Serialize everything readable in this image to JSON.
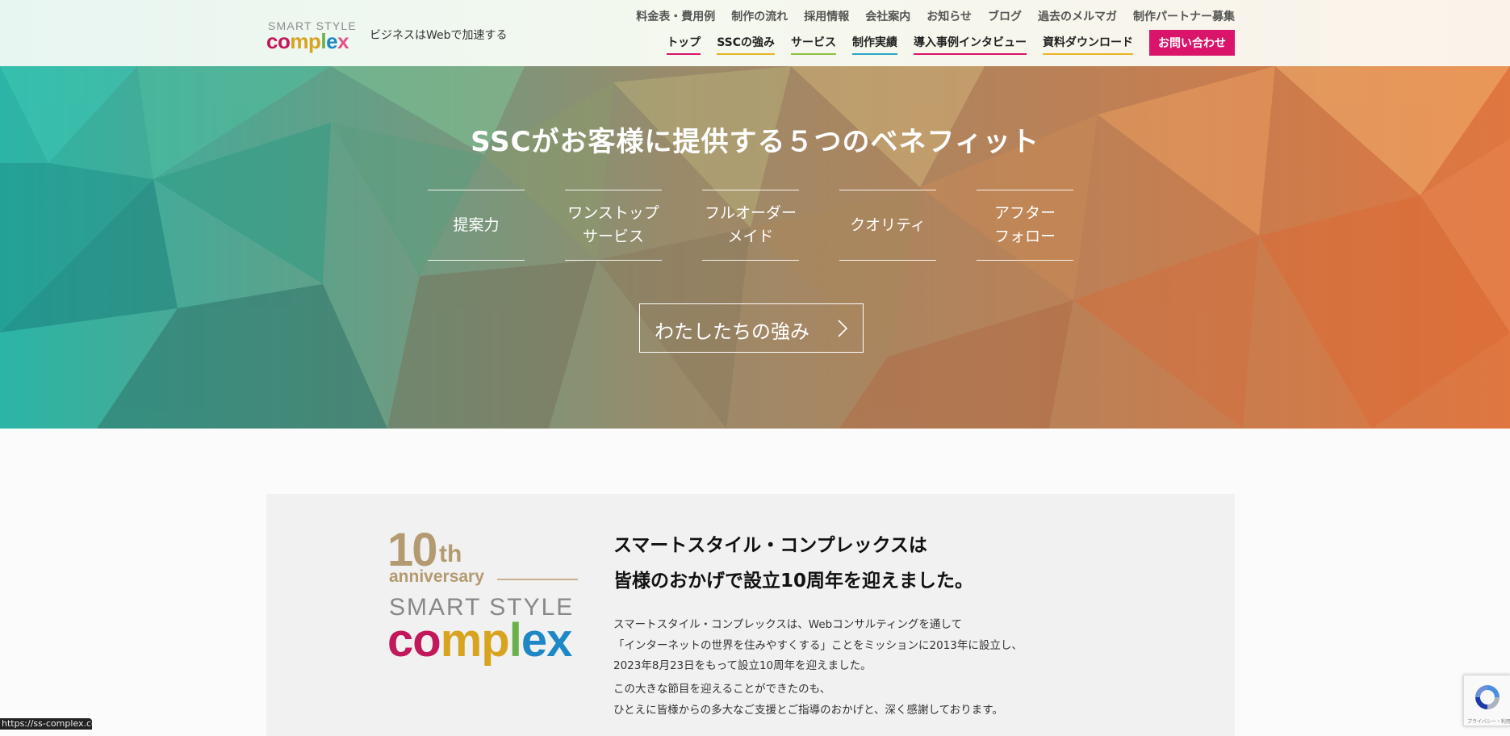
{
  "header": {
    "logo": {
      "small_text": "SMART STYLE",
      "letters": [
        {
          "ch": "c",
          "color": "#c2185b"
        },
        {
          "ch": "o",
          "color": "#c2185b"
        },
        {
          "ch": "m",
          "color": "#d8a31f"
        },
        {
          "ch": "p",
          "color": "#d8a31f"
        },
        {
          "ch": "l",
          "color": "#6ab04c"
        },
        {
          "ch": "e",
          "color": "#1e88c7"
        },
        {
          "ch": "x",
          "color": "#e94e8a"
        }
      ]
    },
    "tagline": "ビジネスはWebで加速する",
    "top_links": [
      {
        "label": "料金表・費用例"
      },
      {
        "label": "制作の流れ"
      },
      {
        "label": "採用情報"
      },
      {
        "label": "会社案内"
      },
      {
        "label": "お知らせ"
      },
      {
        "label": "ブログ"
      },
      {
        "label": "過去のメルマガ"
      },
      {
        "label": "制作パートナー募集"
      }
    ],
    "main_nav": [
      {
        "label": "トップ",
        "underline": "#d9146a"
      },
      {
        "label": "SSCの強み",
        "underline": "#e6b422"
      },
      {
        "label": "サービス",
        "underline": "#8bbf3f"
      },
      {
        "label": "制作実績",
        "underline": "#2aa6c9"
      },
      {
        "label": "導入事例インタビュー",
        "underline": "#d9146a"
      },
      {
        "label": "資料ダウンロード",
        "underline": "#e6b422"
      }
    ],
    "contact_label": "お問い合わせ",
    "contact_color": "#d9146a"
  },
  "hero": {
    "title": "SSCがお客様に提供する５つのベネフィット",
    "benefits": [
      {
        "label": "提案力"
      },
      {
        "label": "ワンストップ\nサービス"
      },
      {
        "label": "フルオーダー\nメイド"
      },
      {
        "label": "クオリティ"
      },
      {
        "label": "アフター\nフォロー"
      }
    ],
    "button_label": "わたしたちの強み",
    "colors": {
      "left": "#2bb5a6",
      "middle": "#9a8a6a",
      "right": "#e07640"
    }
  },
  "anniversary": {
    "logo": {
      "number": "10",
      "suffix": "th",
      "word": "anniversary",
      "small_text": "SMART STYLE",
      "letters": [
        {
          "ch": "c",
          "color": "#c2185b"
        },
        {
          "ch": "o",
          "color": "#c2185b"
        },
        {
          "ch": "m",
          "color": "#d8a31f"
        },
        {
          "ch": "p",
          "color": "#d8a31f"
        },
        {
          "ch": "l",
          "color": "#6ab04c"
        },
        {
          "ch": "e",
          "color": "#1e88c7"
        },
        {
          "ch": "x",
          "color": "#1e88c7"
        }
      ]
    },
    "heading_line1": "スマートスタイル・コンプレックスは",
    "heading_line2": "皆様のおかげで設立10周年を迎えました。",
    "para1_line1": "スマートスタイル・コンプレックスは、Webコンサルティングを通して",
    "para1_line2": "「インターネットの世界を住みやすくする」ことをミッションに2013年に設立し、",
    "para1_line3": "2023年8月23日をもって設立10周年を迎えました。",
    "para2_line1": "この大きな節目を迎えることができたのも、",
    "para2_line2": "ひとえに皆様からの多大なご支援とご指導のおかげと、深く感謝しております。"
  },
  "status_bar": {
    "url": "https://ss-complex.com"
  },
  "recaptcha": {
    "text": "プライバシー・利用規約"
  }
}
